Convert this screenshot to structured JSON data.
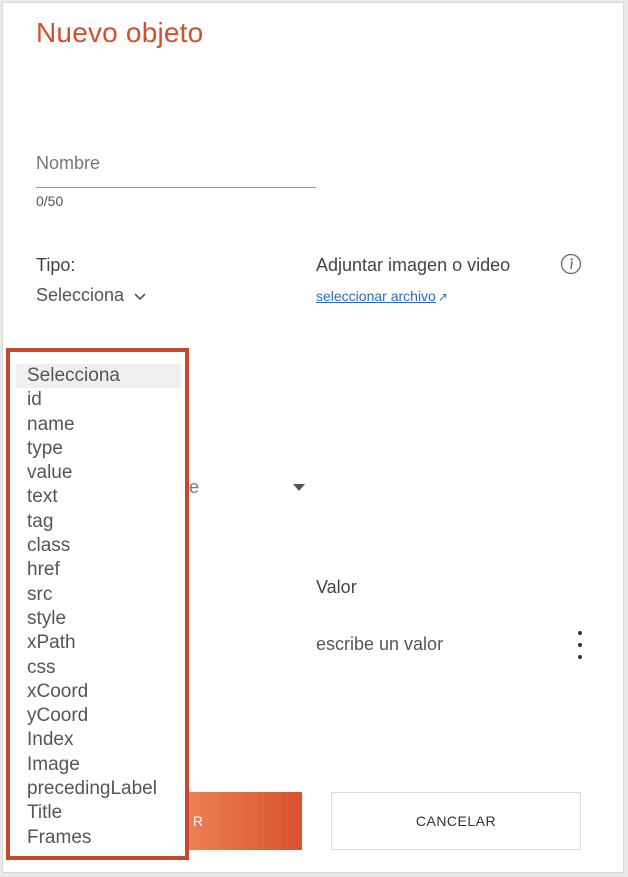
{
  "form": {
    "title": "Nuevo objeto",
    "name_placeholder": "Nombre",
    "name_value": "",
    "counter": "0/50",
    "tipo_label": "Tipo:",
    "tipo_selected": "Selecciona",
    "attach_label": "Adjuntar imagen o video",
    "attach_link": "seleccionar archivo",
    "partial_hidden_text": "e",
    "valor_label": "Valor",
    "valor_placeholder": "escribe un valor",
    "save_label_partial": "R",
    "cancel_label": "CANCELAR"
  },
  "dropdown": {
    "options": [
      "Selecciona",
      "id",
      "name",
      "type",
      "value",
      "text",
      "tag",
      "class",
      "href",
      "src",
      "style",
      "xPath",
      "css",
      "xCoord",
      "yCoord",
      "Index",
      "Image",
      "precedingLabel",
      "Title",
      "Frames"
    ],
    "selected_index": 0
  },
  "icons": {
    "info": "info-circle-icon",
    "external_link": "external-link-icon",
    "chevron": "chevron-down-icon",
    "kebab": "more-vertical-icon"
  },
  "colors": {
    "accent": "#d1502f",
    "link": "#2a6fb8",
    "dropdown_border": "#c7482b"
  }
}
